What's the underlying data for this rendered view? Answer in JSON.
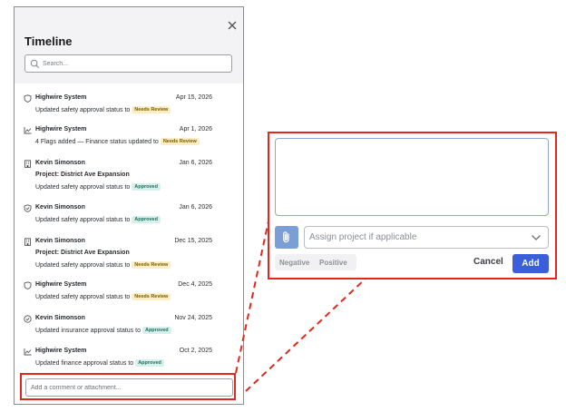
{
  "panel": {
    "title": "Timeline",
    "search_placeholder": "Search...",
    "comment_placeholder": "Add a comment or attachment..."
  },
  "entries": [
    {
      "icon": "shield-icon",
      "author": "Highwire System",
      "date": "Apr 15, 2026",
      "lines": [
        {
          "text": "Updated safety approval status to",
          "badge": "Needs Review",
          "badge_type": "warn"
        }
      ]
    },
    {
      "icon": "trend-icon",
      "author": "Highwire System",
      "date": "Apr 1, 2026",
      "lines": [
        {
          "text": "4 Flags added — Finance status updated to",
          "badge": "Needs Review",
          "badge_type": "warn"
        }
      ]
    },
    {
      "icon": "building-icon",
      "author": "Kevin Simonson",
      "date": "Jan 6, 2026",
      "lines": [
        {
          "text": "Project: District Ave Expansion",
          "bold": true
        },
        {
          "text": "Updated safety approval status to",
          "badge": "Approved",
          "badge_type": "ok"
        }
      ]
    },
    {
      "icon": "shield-check-icon",
      "author": "Kevin Simonson",
      "date": "Jan 6, 2026",
      "lines": [
        {
          "text": "Updated safety approval status to",
          "badge": "Approved",
          "badge_type": "ok"
        }
      ]
    },
    {
      "icon": "building-icon",
      "author": "Kevin Simonson",
      "date": "Dec 15, 2025",
      "lines": [
        {
          "text": "Project: District Ave Expansion",
          "bold": true
        },
        {
          "text": "Updated safety approval status to",
          "badge": "Needs Review",
          "badge_type": "warn"
        }
      ]
    },
    {
      "icon": "shield-icon",
      "author": "Highwire System",
      "date": "Dec 4, 2025",
      "lines": [
        {
          "text": "Updated safety approval status to",
          "badge": "Needs Review",
          "badge_type": "warn"
        }
      ]
    },
    {
      "icon": "check-circle-icon",
      "author": "Kevin Simonson",
      "date": "Nov 24, 2025",
      "lines": [
        {
          "text": "Updated insurance approval status to",
          "badge": "Approved",
          "badge_type": "ok"
        }
      ]
    },
    {
      "icon": "trend-icon",
      "author": "Highwire System",
      "date": "Oct 2, 2025",
      "lines": [
        {
          "text": "Updated finance approval status to",
          "badge": "Approved",
          "badge_type": "ok"
        }
      ]
    }
  ],
  "composer": {
    "project_placeholder": "Assign project if applicable",
    "tone_negative": "Negative",
    "tone_positive": "Positive",
    "cancel_label": "Cancel",
    "add_label": "Add"
  },
  "colors": {
    "highlight": "#e0281e",
    "primary": "#3b5fd9",
    "attach": "#7b9ed6",
    "badge_warn_bg": "#fbeec2",
    "badge_ok_bg": "#d6f1ec"
  }
}
